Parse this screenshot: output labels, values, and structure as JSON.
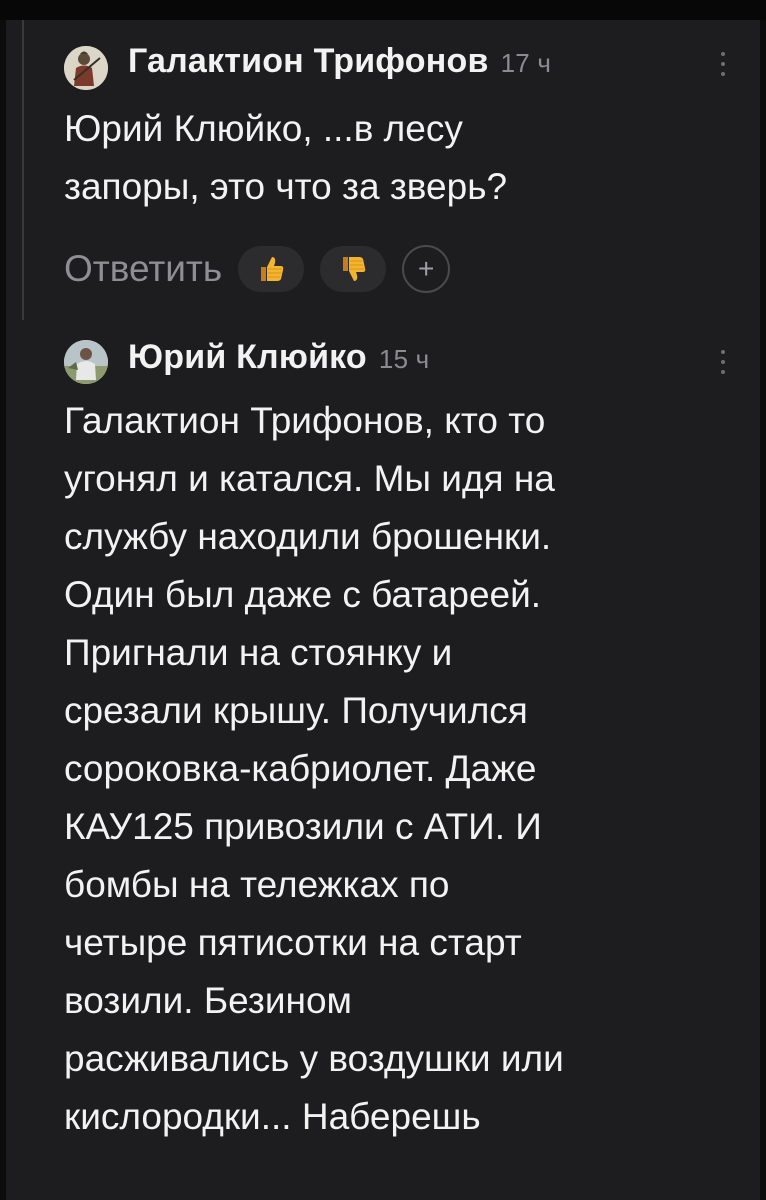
{
  "comments": [
    {
      "author": "Галактион Трифонов",
      "time": "17 ч",
      "lines": [
        "Юрий Клюйко, ...в лесу",
        "запоры, это что за зверь?"
      ],
      "reply_label": "Ответить",
      "reactions": [
        "like-icon",
        "dislike-icon"
      ],
      "add_reaction": "+"
    },
    {
      "author": "Юрий Клюйко",
      "time": "15 ч",
      "lines": [
        "Галактион Трифонов, кто то",
        "угонял и катался. Мы идя на",
        "службу находили брошенки.",
        "Один был даже с батареей.",
        "Пригнали на стоянку и",
        "срезали крышу. Получился",
        "сороковка-кабриолет. Даже",
        "КАУ125 привозили с АТИ. И",
        "бомбы на тележках по",
        "четыре пятисотки на старт",
        "возили. Безином",
        "расживались у воздушки или",
        "кислородки... Наберешь"
      ]
    }
  ],
  "colors": {
    "background": "#1d1d1f",
    "text": "#f2f2f2",
    "muted": "#8e8e93"
  }
}
